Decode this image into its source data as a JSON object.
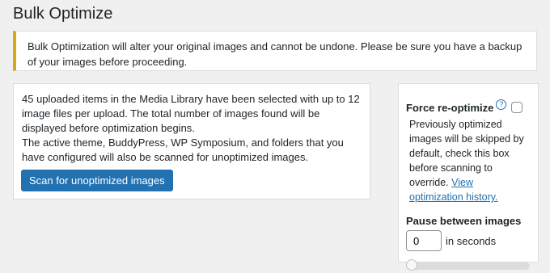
{
  "page": {
    "title": "Bulk Optimize"
  },
  "notice": {
    "text": "Bulk Optimization will alter your original images and cannot be undone. Please be sure you have a backup of your images before proceeding."
  },
  "main": {
    "line1": "45 uploaded items in the Media Library have been selected with up to 12 image files per upload. The total number of images found will be displayed before optimization begins.",
    "line2": "The active theme, BuddyPress, WP Symposium, and folders that you have configured will also be scanned for unoptimized images.",
    "scan_button": "Scan for unoptimized images"
  },
  "side": {
    "force_label": "Force re-optimize",
    "help_icon": "?",
    "force_checked": false,
    "force_desc": "Previously optimized images will be skipped by default, check this box before scanning to override.",
    "history_link": "View optimization history.",
    "pause_label": "Pause between images",
    "pause_value": "0",
    "pause_unit": "in seconds",
    "pause_slider_value": 0
  },
  "colors": {
    "accent": "#2271b1",
    "warning": "#dba617"
  }
}
